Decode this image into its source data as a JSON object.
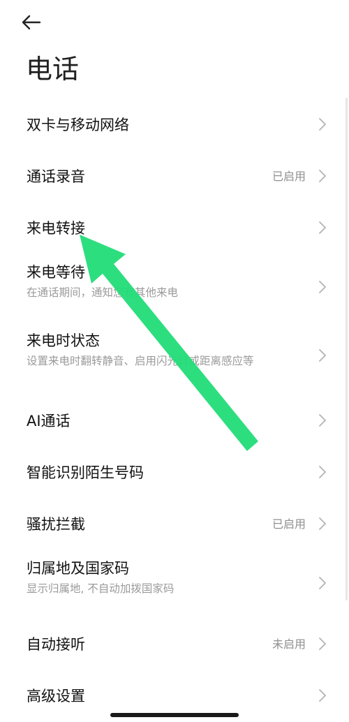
{
  "header": {
    "back_icon": "arrow-left-icon",
    "title": "电话"
  },
  "settings": {
    "items": [
      {
        "label": "双卡与移动网络",
        "subtitle": "",
        "value": ""
      },
      {
        "label": "通话录音",
        "subtitle": "",
        "value": "已启用"
      },
      {
        "label": "来电转接",
        "subtitle": "",
        "value": ""
      },
      {
        "label": "来电等待",
        "subtitle": "在通话期间，通知您有其他来电",
        "value": ""
      },
      {
        "label": "来电时状态",
        "subtitle": "设置来电时翻转静音、启用闪光灯或距离感应等",
        "value": ""
      },
      {
        "label": "AI通话",
        "subtitle": "",
        "value": ""
      },
      {
        "label": "智能识别陌生号码",
        "subtitle": "",
        "value": ""
      },
      {
        "label": "骚扰拦截",
        "subtitle": "",
        "value": "已启用"
      },
      {
        "label": "归属地及国家码",
        "subtitle": "显示归属地, 不自动加拨国家码",
        "value": ""
      },
      {
        "label": "自动接听",
        "subtitle": "",
        "value": "未启用"
      },
      {
        "label": "高级设置",
        "subtitle": "",
        "value": ""
      }
    ]
  },
  "annotation": {
    "color": "#22dc78",
    "icon": "green-arrow-annotation"
  }
}
